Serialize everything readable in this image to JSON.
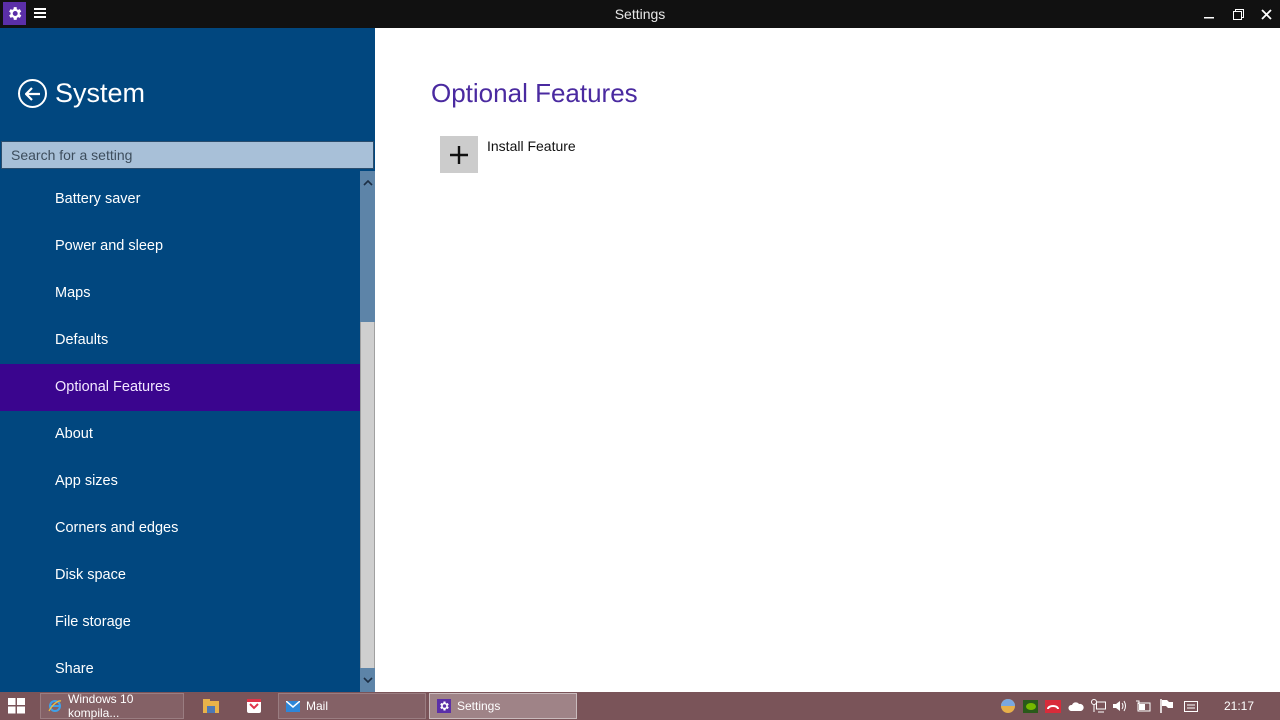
{
  "window": {
    "title": "Settings",
    "app_icon": "gear-icon",
    "menu_icon": "hamburger-icon",
    "controls": [
      "minimize-icon",
      "restore-icon",
      "close-icon"
    ]
  },
  "sidebar": {
    "back_icon": "back-arrow-icon",
    "title": "System",
    "search_placeholder": "Search for a setting",
    "search_value": "",
    "items": [
      {
        "label": "Battery saver",
        "active": false
      },
      {
        "label": "Power and sleep",
        "active": false
      },
      {
        "label": "Maps",
        "active": false
      },
      {
        "label": "Defaults",
        "active": false
      },
      {
        "label": "Optional Features",
        "active": true
      },
      {
        "label": "About",
        "active": false
      },
      {
        "label": "App sizes",
        "active": false
      },
      {
        "label": "Corners and edges",
        "active": false
      },
      {
        "label": "Disk space",
        "active": false
      },
      {
        "label": "File storage",
        "active": false
      },
      {
        "label": "Share",
        "active": false
      }
    ]
  },
  "main": {
    "title": "Optional Features",
    "install_icon": "plus-icon",
    "install_label": "Install Feature"
  },
  "taskbar": {
    "start_icon": "windows-logo-icon",
    "buttons": [
      {
        "label": "Windows 10 kompila...",
        "icon": "internet-explorer-icon",
        "active": false
      },
      {
        "label": "",
        "icon": "file-explorer-icon",
        "active": false
      },
      {
        "label": "",
        "icon": "pocket-icon",
        "active": false
      },
      {
        "label": "Mail",
        "icon": "mail-icon",
        "active": false
      },
      {
        "label": "Settings",
        "icon": "gear-icon",
        "active": true
      }
    ],
    "tray_icons": [
      "chrome-icon",
      "nvidia-icon",
      "network-device-icon",
      "onedrive-icon",
      "network-icon",
      "volume-icon",
      "battery-icon",
      "action-flag-icon",
      "notifications-icon"
    ],
    "clock": "21:17"
  },
  "colors": {
    "sidebar_bg": "#01477f",
    "active_item_bg": "#3a058e",
    "accent_title": "#4a2aa0",
    "titlebar_bg": "#111111",
    "taskbar_bg": "#7a5459"
  }
}
